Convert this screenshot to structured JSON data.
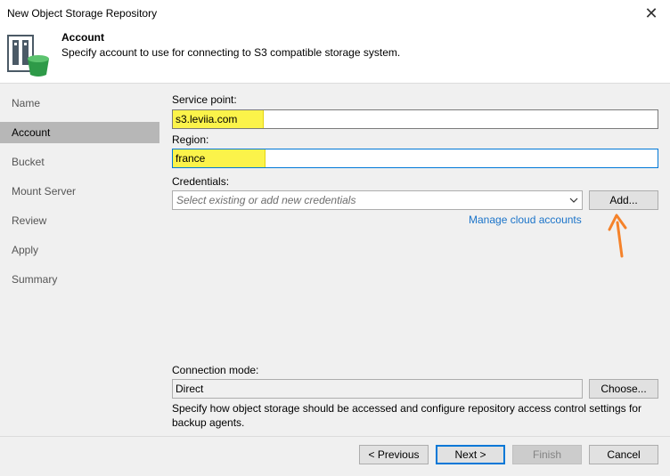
{
  "window": {
    "title": "New Object Storage Repository",
    "close_glyph": "✕"
  },
  "header": {
    "title": "Account",
    "description": "Specify account to use for connecting to S3 compatible storage system.",
    "icon": "object-storage-icon"
  },
  "sidebar": {
    "items": [
      {
        "label": "Name",
        "active": false
      },
      {
        "label": "Account",
        "active": true
      },
      {
        "label": "Bucket",
        "active": false
      },
      {
        "label": "Mount Server",
        "active": false
      },
      {
        "label": "Review",
        "active": false
      },
      {
        "label": "Apply",
        "active": false
      },
      {
        "label": "Summary",
        "active": false
      }
    ]
  },
  "form": {
    "service_point": {
      "label": "Service point:",
      "value": "s3.leviia.com"
    },
    "region": {
      "label": "Region:",
      "value": "france"
    },
    "credentials": {
      "label": "Credentials:",
      "placeholder": "Select existing or add new credentials",
      "add_label": "Add...",
      "manage_link": "Manage cloud accounts"
    },
    "connection_mode": {
      "label": "Connection mode:",
      "value": "Direct",
      "choose_label": "Choose...",
      "description": "Specify how object storage should be accessed and configure repository access control settings for backup agents."
    }
  },
  "footer": {
    "previous_label": "< Previous",
    "next_label": "Next >",
    "finish_label": "Finish",
    "cancel_label": "Cancel"
  },
  "colors": {
    "highlight": "#fbf34a",
    "annotation_arrow": "#f5822a",
    "link": "#1a73c9",
    "focus_border": "#0078d7"
  }
}
